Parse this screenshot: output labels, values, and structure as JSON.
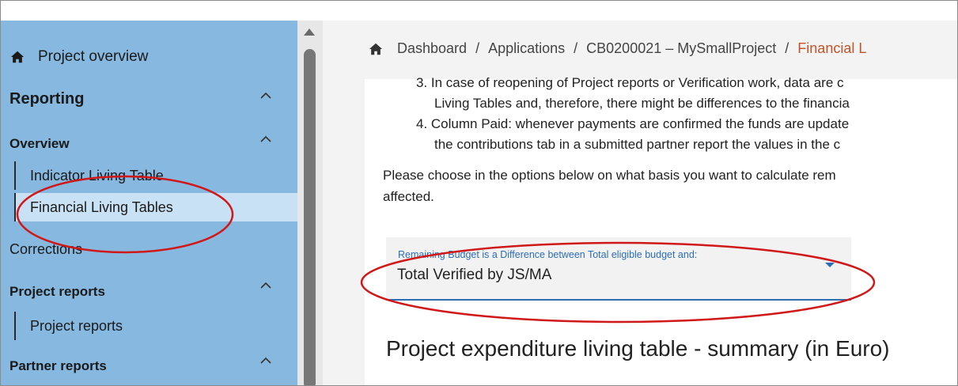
{
  "sidebar": {
    "project_overview": "Project overview",
    "sections": [
      {
        "label": "Reporting"
      },
      {
        "label": "Overview"
      },
      {
        "label": "Corrections"
      },
      {
        "label": "Project reports"
      },
      {
        "label": "Partner reports"
      }
    ],
    "items": [
      {
        "label": "Indicator Living Table"
      },
      {
        "label": "Financial Living Tables"
      },
      {
        "label": "Project reports"
      }
    ]
  },
  "breadcrumb": {
    "items": [
      "Dashboard",
      "Applications",
      "CB0200021 – MySmallProject",
      "Financial L"
    ],
    "separator": "/"
  },
  "content": {
    "lines": [
      "3. In case of reopening of Project reports or  Verification work, data are c",
      "Living Tables and, therefore, there might be differences to the financia",
      "4. Column Paid: whenever payments are confirmed the funds are update",
      "the contributions tab in a submitted partner report the values in the c",
      "Please choose in the options below on what basis you want to calculate rem",
      "affected."
    ],
    "select": {
      "label": "Remaining Budget is a Difference between Total eligible budget and:",
      "value": "Total Verified by JS/MA"
    },
    "heading": "Project expenditure living table - summary (in Euro)"
  },
  "colors": {
    "sidebar_bg": "#86b8e0",
    "active_item_bg": "#c9e1f5",
    "accent_blue": "#2d6db4",
    "breadcrumb_current": "#c0542a",
    "annotation_red": "#d01818"
  },
  "icons": {
    "home": "home-icon",
    "chevron": "chevron-up-icon",
    "caret": "caret-down-icon"
  }
}
